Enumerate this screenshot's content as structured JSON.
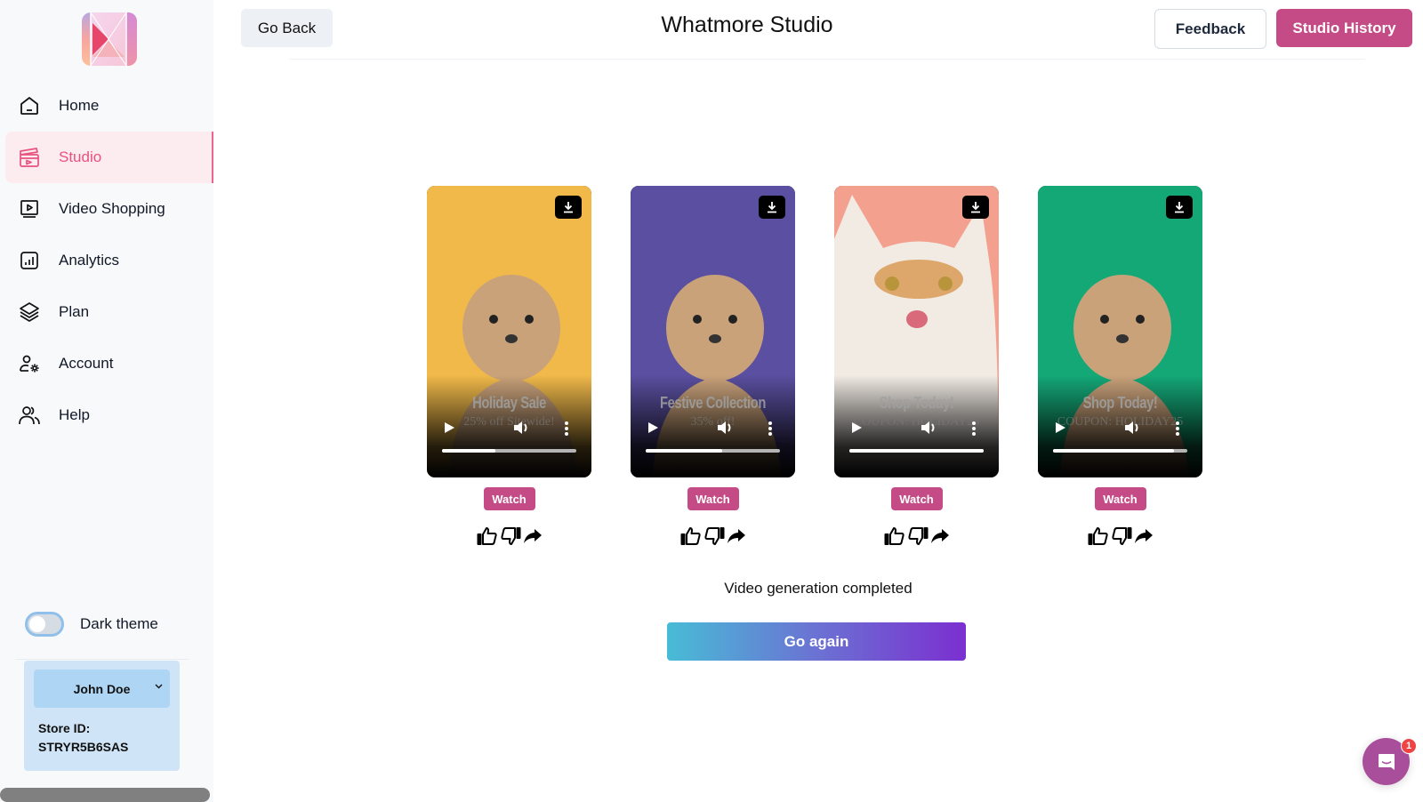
{
  "sidebar": {
    "logo_alt": "app-logo",
    "items": [
      {
        "label": "Home",
        "icon": "home-icon",
        "active": false
      },
      {
        "label": "Studio",
        "icon": "clapperboard-icon",
        "active": true
      },
      {
        "label": "Video Shopping",
        "icon": "video-player-icon",
        "active": false
      },
      {
        "label": "Analytics",
        "icon": "bar-chart-icon",
        "active": false
      },
      {
        "label": "Plan",
        "icon": "layers-icon",
        "active": false
      },
      {
        "label": "Account",
        "icon": "user-settings-icon",
        "active": false
      },
      {
        "label": "Help",
        "icon": "users-icon",
        "active": false
      }
    ],
    "theme_toggle": {
      "label": "Dark theme",
      "on": false
    },
    "account": {
      "user_name": "John Doe",
      "store_id_label": "Store ID:",
      "store_id": "STRYR5B6SAS"
    }
  },
  "header": {
    "back_label": "Go Back",
    "title": "Whatmore Studio",
    "feedback_label": "Feedback",
    "history_label": "Studio History"
  },
  "videos": [
    {
      "overlay_title": "Holiday Sale",
      "overlay_sub": "25% off Sitewide!",
      "progress_pct": 40,
      "watch_label": "Watch",
      "bg": "#f0b94a",
      "subject": "dog"
    },
    {
      "overlay_title": "Festive Collection",
      "overlay_sub": "35% off!",
      "progress_pct": 57,
      "watch_label": "Watch",
      "bg": "#5a4fa0",
      "subject": "dog"
    },
    {
      "overlay_title": "Shop Today!",
      "overlay_sub": "COUPON: HOLIDAY25",
      "progress_pct": 100,
      "watch_label": "Watch",
      "bg": "#f3a08e",
      "subject": "cat"
    },
    {
      "overlay_title": "Shop Today!",
      "overlay_sub": "COUPON: HOLIDAY25",
      "progress_pct": 90,
      "watch_label": "Watch",
      "bg": "#14a877",
      "subject": "dog"
    }
  ],
  "status": "Video generation completed",
  "go_again_label": "Go again",
  "chat": {
    "unread_count": "1"
  },
  "colors": {
    "accent": "#c44b85",
    "active_nav": "#e8527e",
    "active_nav_bg": "#fdecef"
  }
}
